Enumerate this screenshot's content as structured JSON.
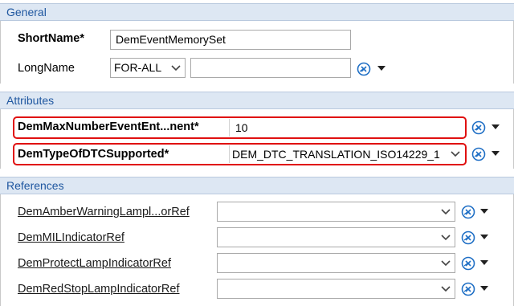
{
  "general": {
    "header": "General",
    "short_name_label": "ShortName*",
    "short_name_value": "DemEventMemorySet",
    "long_name_label": "LongName",
    "long_name_lang": "FOR-ALL",
    "long_name_value": ""
  },
  "attributes": {
    "header": "Attributes",
    "max_events_label": "DemMaxNumberEventEnt...nent*",
    "max_events_value": "10",
    "dtc_type_label": "DemTypeOfDTCSupported*",
    "dtc_type_value": "DEM_DTC_TRANSLATION_ISO14229_1"
  },
  "references": {
    "header": "References",
    "items": [
      {
        "label": "DemAmberWarningLampl...orRef",
        "value": ""
      },
      {
        "label": "DemMILIndicatorRef",
        "value": ""
      },
      {
        "label": "DemProtectLampIndicatorRef",
        "value": ""
      },
      {
        "label": "DemRedStopLampIndicatorRef",
        "value": ""
      }
    ]
  },
  "colors": {
    "header_bg": "#dde7f3",
    "header_text": "#1f57a0",
    "highlight": "#e01010",
    "icon_blue": "#1f6fc5"
  },
  "icons": [
    "clear-icon",
    "dropdown-arrow-icon",
    "chevron-down-icon"
  ]
}
